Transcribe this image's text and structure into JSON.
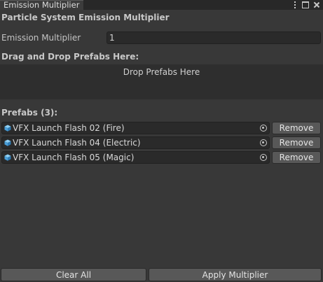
{
  "window": {
    "tab_title": "Emission Multiplier"
  },
  "header": {
    "title": "Particle System Emission Multiplier"
  },
  "multiplier_field": {
    "label": "Emission Multiplier",
    "value": "1"
  },
  "dropzone": {
    "heading": "Drag and Drop Prefabs Here:",
    "placeholder": "Drop Prefabs Here"
  },
  "prefabs": {
    "heading": "Prefabs (3):",
    "remove_label": "Remove",
    "items": [
      {
        "name": "VFX Launch Flash 02 (Fire)"
      },
      {
        "name": "VFX Launch Flash 04 (Electric)"
      },
      {
        "name": "VFX Launch Flash 05 (Magic)"
      }
    ]
  },
  "footer": {
    "clear_label": "Clear All",
    "apply_label": "Apply Multiplier"
  },
  "icons": {
    "prefab": "prefab-cube-icon",
    "picker": "object-picker-icon",
    "menu": "kebab-menu-icon",
    "maximize": "maximize-icon",
    "close": "close-icon"
  },
  "colors": {
    "background": "#383838",
    "field_background": "#2a2a2a",
    "button_background": "#585858",
    "prefab_icon": "#5fb0e6"
  }
}
